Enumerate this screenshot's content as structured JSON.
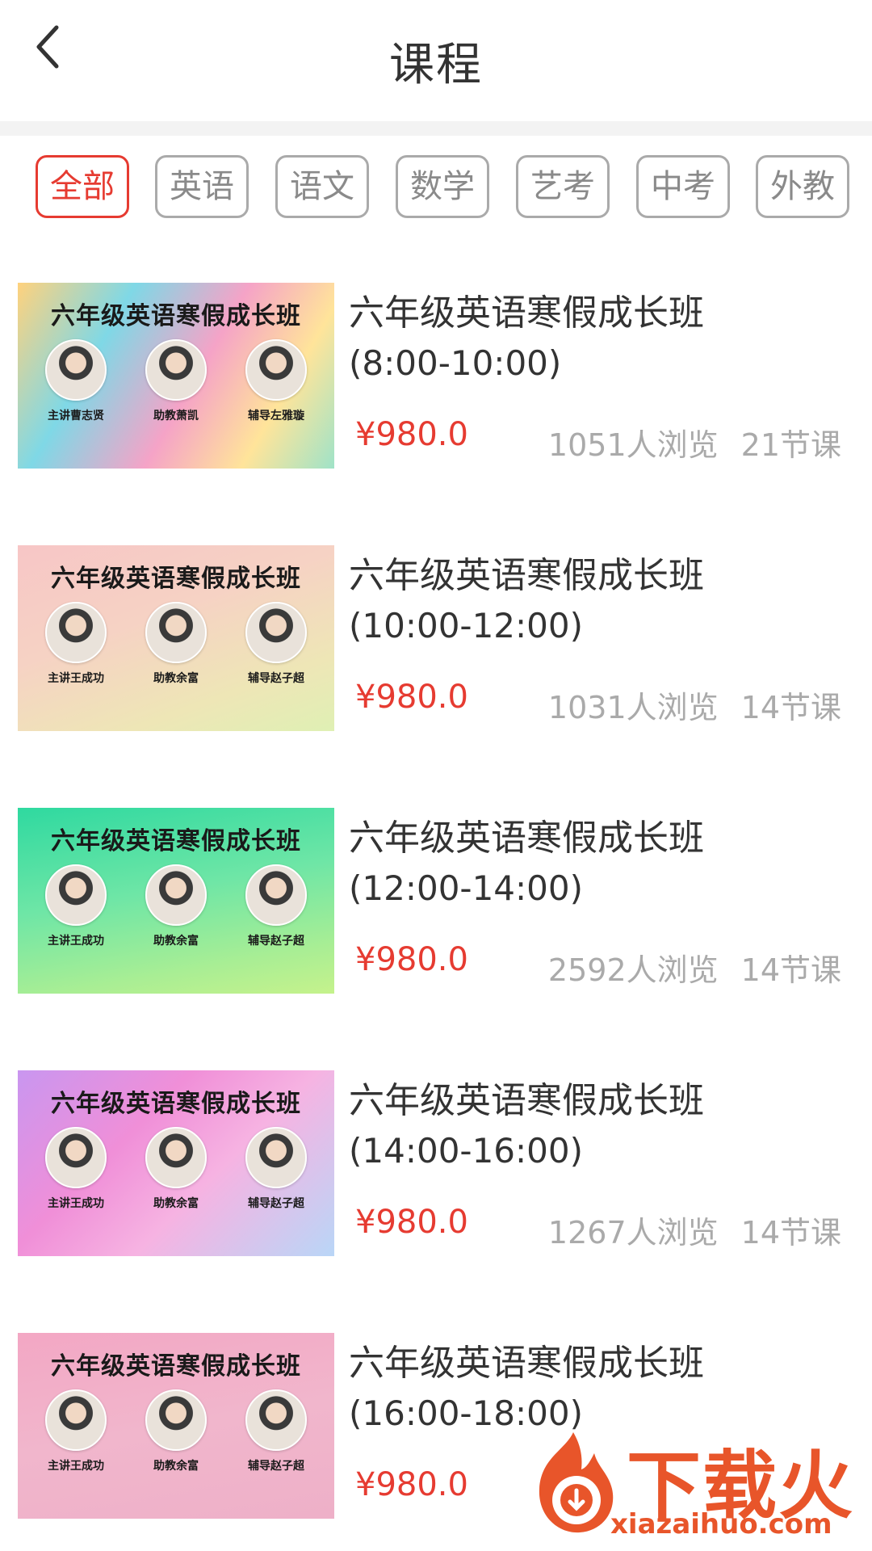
{
  "header": {
    "title": "课程",
    "back_icon": "back-icon"
  },
  "tabs": [
    {
      "label": "全部",
      "active": true
    },
    {
      "label": "英语"
    },
    {
      "label": "语文"
    },
    {
      "label": "数学"
    },
    {
      "label": "艺考"
    },
    {
      "label": "中考"
    },
    {
      "label": "外教"
    }
  ],
  "colors": {
    "accent": "#e63b31",
    "muted_text": "#aaaaaa",
    "watermark": "#e8552a"
  },
  "courses": [
    {
      "thumb_title": "六年级英语寒假成长班",
      "teachers": [
        "主讲曹志贤",
        "助教萧凯",
        "辅导左雅璇"
      ],
      "title": "六年级英语寒假成长班",
      "time": "(8:00-10:00)",
      "price": "¥980.0",
      "views": "1051人浏览",
      "lessons": "21节课"
    },
    {
      "thumb_title": "六年级英语寒假成长班",
      "teachers": [
        "主讲王成功",
        "助教余富",
        "辅导赵子超"
      ],
      "title": "六年级英语寒假成长班",
      "time": "(10:00-12:00)",
      "price": "¥980.0",
      "views": "1031人浏览",
      "lessons": "14节课"
    },
    {
      "thumb_title": "六年级英语寒假成长班",
      "teachers": [
        "主讲王成功",
        "助教余富",
        "辅导赵子超"
      ],
      "title": "六年级英语寒假成长班",
      "time": "(12:00-14:00)",
      "price": "¥980.0",
      "views": "2592人浏览",
      "lessons": "14节课"
    },
    {
      "thumb_title": "六年级英语寒假成长班",
      "teachers": [
        "主讲王成功",
        "助教余富",
        "辅导赵子超"
      ],
      "title": "六年级英语寒假成长班",
      "time": "(14:00-16:00)",
      "price": "¥980.0",
      "views": "1267人浏览",
      "lessons": "14节课"
    },
    {
      "thumb_title": "六年级英语寒假成长班",
      "teachers": [
        "主讲王成功",
        "助教余富",
        "辅导赵子超"
      ],
      "title": "六年级英语寒假成长班",
      "time": "(16:00-18:00)",
      "price": "¥980.0"
    }
  ],
  "watermark": {
    "text": "下载火",
    "url": "xiazaihuo.com"
  }
}
